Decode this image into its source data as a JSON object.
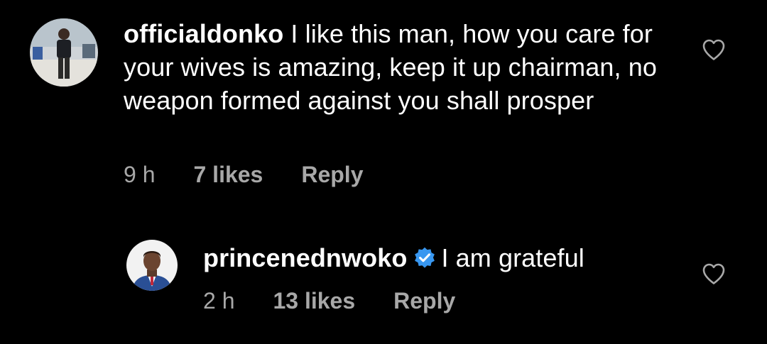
{
  "colors": {
    "background": "#000000",
    "text": "#ffffff",
    "meta": "#a8a8a8",
    "verified": "#3897f0"
  },
  "comments": [
    {
      "username": "officialdonko",
      "text": "I like this man, how you care for your wives is amazing, keep it up chairman, no weapon formed against you shall prosper",
      "time": "9 h",
      "likes": "7 likes",
      "reply_label": "Reply",
      "avatar_icon": "user-avatar-photo",
      "like_icon": "heart-outline-icon"
    },
    {
      "username": "princenednwoko",
      "verified": true,
      "text": "I am grateful",
      "time": "2 h",
      "likes": "13 likes",
      "reply_label": "Reply",
      "avatar_icon": "user-avatar-photo",
      "like_icon": "heart-outline-icon"
    }
  ]
}
